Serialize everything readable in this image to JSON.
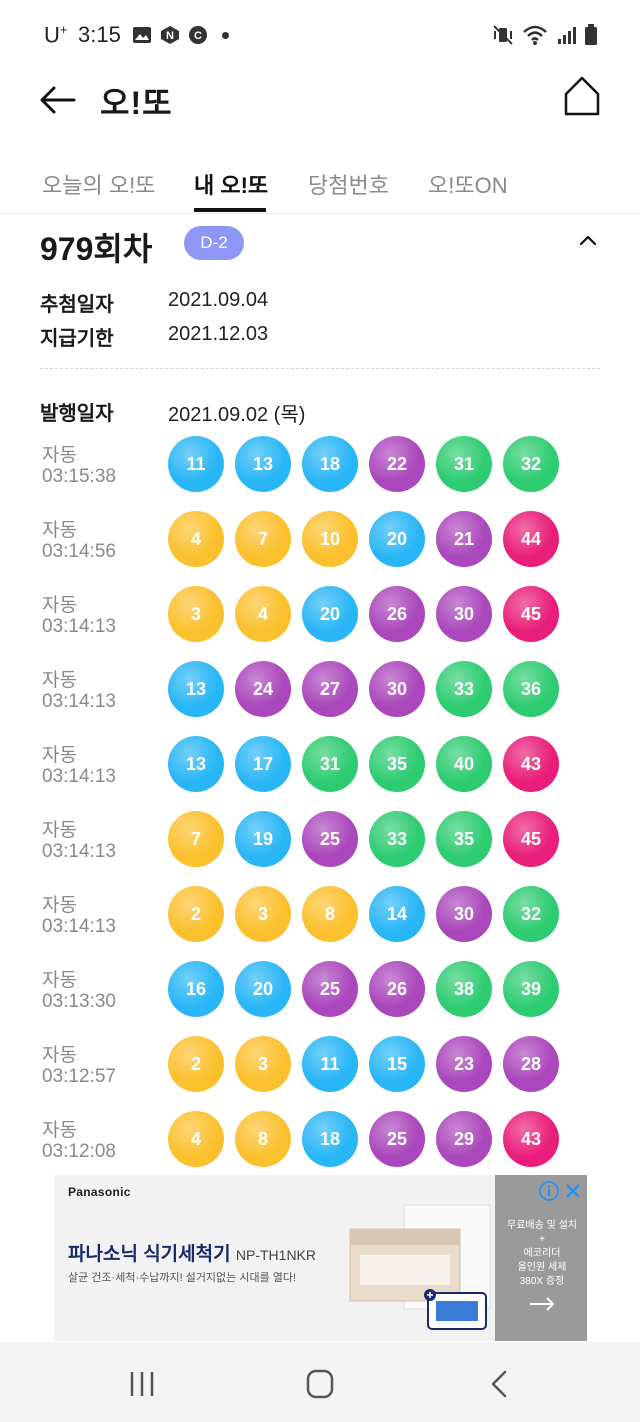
{
  "status_bar": {
    "carrier": "U",
    "carrier_sup": "+",
    "time": "3:15"
  },
  "header": {
    "title": "오!또"
  },
  "tabs": [
    {
      "label": "오늘의 오!또",
      "active": false
    },
    {
      "label": "내 오!또",
      "active": true
    },
    {
      "label": "당첨번호",
      "active": false
    },
    {
      "label": "오!또ON",
      "active": false
    }
  ],
  "round": {
    "title": "979회차",
    "badge": "D-2"
  },
  "info": {
    "draw_date_label": "추첨일자",
    "draw_date": "2021.09.04",
    "deadline_label": "지급기한",
    "deadline": "2021.12.03",
    "issue_date_label": "발행일자",
    "issue_date": "2021.09.02 (목)"
  },
  "ball_colors": {
    "yellow": "#fbc02d",
    "blue": "#29b6f6",
    "purple": "#ab47bc",
    "green": "#2ecc71",
    "pink": "#e91e7a"
  },
  "tickets": [
    {
      "mode": "자동",
      "time": "03:15:38",
      "numbers": [
        11,
        13,
        18,
        22,
        31,
        32
      ]
    },
    {
      "mode": "자동",
      "time": "03:14:56",
      "numbers": [
        4,
        7,
        10,
        20,
        21,
        44
      ]
    },
    {
      "mode": "자동",
      "time": "03:14:13",
      "numbers": [
        3,
        4,
        20,
        26,
        30,
        45
      ]
    },
    {
      "mode": "자동",
      "time": "03:14:13",
      "numbers": [
        13,
        24,
        27,
        30,
        33,
        36
      ]
    },
    {
      "mode": "자동",
      "time": "03:14:13",
      "numbers": [
        13,
        17,
        31,
        35,
        40,
        43
      ]
    },
    {
      "mode": "자동",
      "time": "03:14:13",
      "numbers": [
        7,
        19,
        25,
        33,
        35,
        45
      ]
    },
    {
      "mode": "자동",
      "time": "03:14:13",
      "numbers": [
        2,
        3,
        8,
        14,
        30,
        32
      ]
    },
    {
      "mode": "자동",
      "time": "03:13:30",
      "numbers": [
        16,
        20,
        25,
        26,
        38,
        39
      ]
    },
    {
      "mode": "자동",
      "time": "03:12:57",
      "numbers": [
        2,
        3,
        11,
        15,
        23,
        28
      ]
    },
    {
      "mode": "자동",
      "time": "03:12:08",
      "numbers": [
        4,
        8,
        18,
        25,
        29,
        43
      ]
    }
  ],
  "ad": {
    "brand": "Panasonic",
    "headline": "파나소닉 식기세척기",
    "model": "NP-TH1NKR",
    "subtext": "살균 건조·세척·수납까지! 설거지없는 시대를 열다!",
    "side_line1": "무료배송 및 설치",
    "side_line2": "+",
    "side_line3": "에코리더",
    "side_line4": "올인원 세제",
    "side_line5": "380X 증정"
  }
}
